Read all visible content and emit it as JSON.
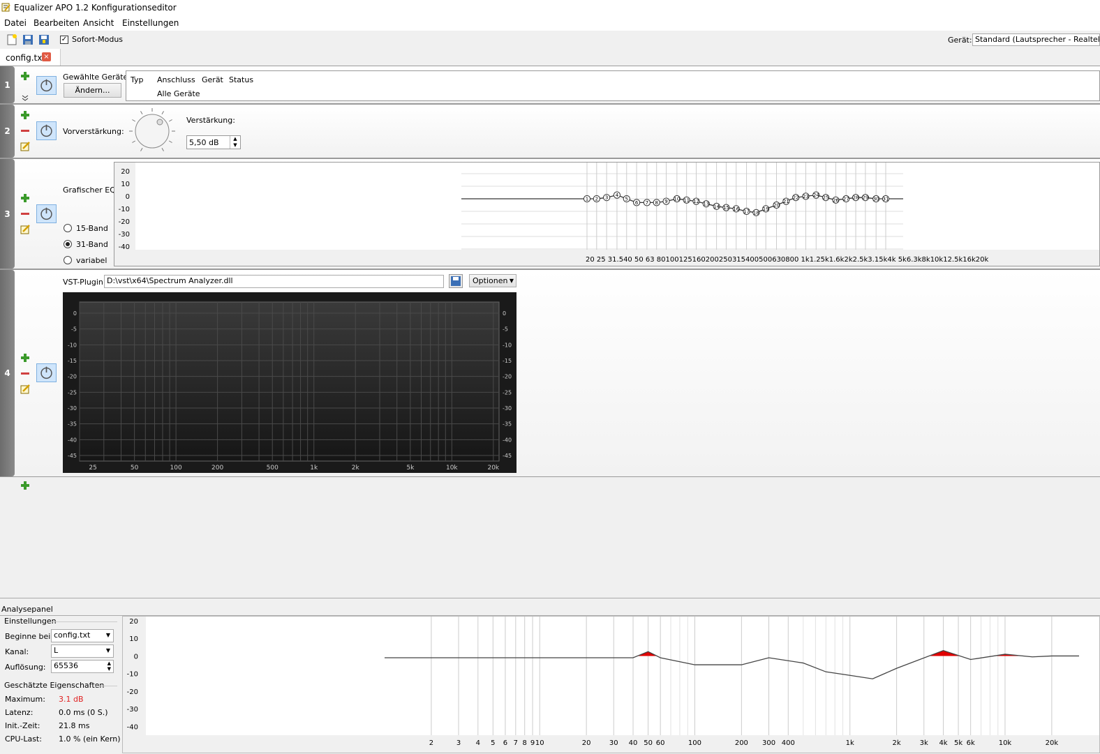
{
  "window": {
    "title": "Equalizer APO 1.2 Konfigurationseditor"
  },
  "menu": [
    "Datei",
    "Bearbeiten",
    "Ansicht",
    "Einstellungen"
  ],
  "toolbar": {
    "instant_label": "Sofort-Modus",
    "instant_checked": true,
    "device_label": "Gerät:",
    "device_value": "Standard (Lautsprecher - Realtek Hi"
  },
  "tab": {
    "label": "config.txt",
    "close": "×"
  },
  "filter1": {
    "num": "1",
    "selected_label": "Gewählte Geräte:",
    "change_button": "Ändern...",
    "columns": [
      "Typ",
      "Anschluss",
      "Gerät",
      "Status"
    ],
    "row": "Alle Geräte"
  },
  "filter2": {
    "num": "2",
    "preamp_label": "Vorverstärkung:",
    "gain_label": "Verstärkung:",
    "gain_value": "5,50 dB"
  },
  "filter3": {
    "num": "3",
    "label": "Grafischer EQ:",
    "radios": [
      {
        "label": "15-Band",
        "checked": false
      },
      {
        "label": "31-Band",
        "checked": true
      },
      {
        "label": "variabel",
        "checked": false
      }
    ],
    "y_ticks": [
      "20",
      "10",
      "0",
      "-10",
      "-20",
      "-30",
      "-40"
    ],
    "x_ticks": "20 25 31.540 50 63 80100125160200250315400500630800 1k1.25k1.6k2k2.5k3.15k4k 5k6.3k8k10k12.5k16k20k",
    "bands": [
      "1",
      "2",
      "3",
      "4",
      "5",
      "6",
      "7",
      "8",
      "9",
      "10",
      "11",
      "12",
      "13",
      "14",
      "15",
      "16",
      "17",
      "18",
      "19",
      "20",
      "21",
      "22",
      "23",
      "24",
      "25",
      "26",
      "27",
      "28",
      "29",
      "30",
      "31"
    ]
  },
  "filter4": {
    "num": "4",
    "vst_label": "VST-Plugin:",
    "vst_path": "D:\\vst\\x64\\Spectrum Analyzer.dll",
    "options_button": "Optionen",
    "db_ticks": [
      "0",
      "-5",
      "-10",
      "-15",
      "-20",
      "-25",
      "-30",
      "-35",
      "-40",
      "-45"
    ],
    "freq_ticks": [
      "25",
      "50",
      "100",
      "200",
      "500",
      "1k",
      "2k",
      "5k",
      "10k",
      "20k"
    ]
  },
  "analysis": {
    "title": "Analysepanel",
    "settings_title": "Einstellungen",
    "start_label": "Beginne bei:",
    "start_value": "config.txt",
    "channel_label": "Kanal:",
    "channel_value": "L",
    "resolution_label": "Auflösung:",
    "resolution_value": "65536",
    "props_title": "Geschätzte Eigenschaften",
    "props": [
      {
        "key": "Maximum:",
        "value": "3.1 dB",
        "color": "#e02020"
      },
      {
        "key": "Latenz:",
        "value": "0.0 ms (0 S.)",
        "color": "#000000"
      },
      {
        "key": "Init.-Zeit:",
        "value": "21.8 ms",
        "color": "#000000"
      },
      {
        "key": "CPU-Last:",
        "value": "1.0 % (ein Kern)",
        "color": "#000000"
      }
    ],
    "y_ticks": [
      "20",
      "10",
      "0",
      "-10",
      "-20",
      "-30",
      "-40"
    ],
    "x_ticks": [
      "2",
      "3",
      "4",
      "5",
      "6",
      "7",
      "8",
      "9",
      "10",
      "20",
      "30",
      "40",
      "50",
      "60",
      "100",
      "200",
      "300",
      "400",
      "1k",
      "2k",
      "3k",
      "4k",
      "5k",
      "6k",
      "10k",
      "20k"
    ]
  },
  "chart_data": [
    {
      "type": "line",
      "title": "",
      "xlabel": "",
      "ylabel": "",
      "x": [
        20,
        25,
        31.5,
        40,
        50,
        63,
        80,
        100,
        125,
        160,
        200,
        250,
        315,
        400,
        500,
        630,
        800,
        1000,
        1250,
        1600,
        2000,
        2500,
        3150,
        4000,
        5000,
        6300,
        8000,
        10000,
        12500,
        16000,
        20000
      ],
      "values": [
        0,
        0,
        1,
        3,
        0,
        -3,
        -3,
        -3,
        -2,
        0,
        -1,
        -2,
        -4,
        -6,
        -7,
        -8,
        -10,
        -11,
        -8,
        -5,
        -2,
        1,
        2,
        3,
        1,
        -1,
        0,
        1,
        1,
        0,
        0
      ],
      "ylim": [
        -40,
        20
      ]
    },
    {
      "type": "line",
      "title": "",
      "xlabel": "",
      "ylabel": "",
      "x": [
        1,
        10,
        40,
        50,
        60,
        100,
        200,
        300,
        500,
        700,
        1000,
        1400,
        2000,
        4000,
        6000,
        10000,
        15000,
        20000,
        30000
      ],
      "values": [
        -1,
        -1,
        -1,
        2.5,
        -1,
        -5,
        -5,
        -1,
        -4,
        -9,
        -11,
        -13,
        -7,
        3.1,
        -2,
        1,
        -0.5,
        0,
        0
      ],
      "ylim": [
        -45,
        20
      ],
      "xlim": [
        1,
        30000
      ]
    }
  ]
}
